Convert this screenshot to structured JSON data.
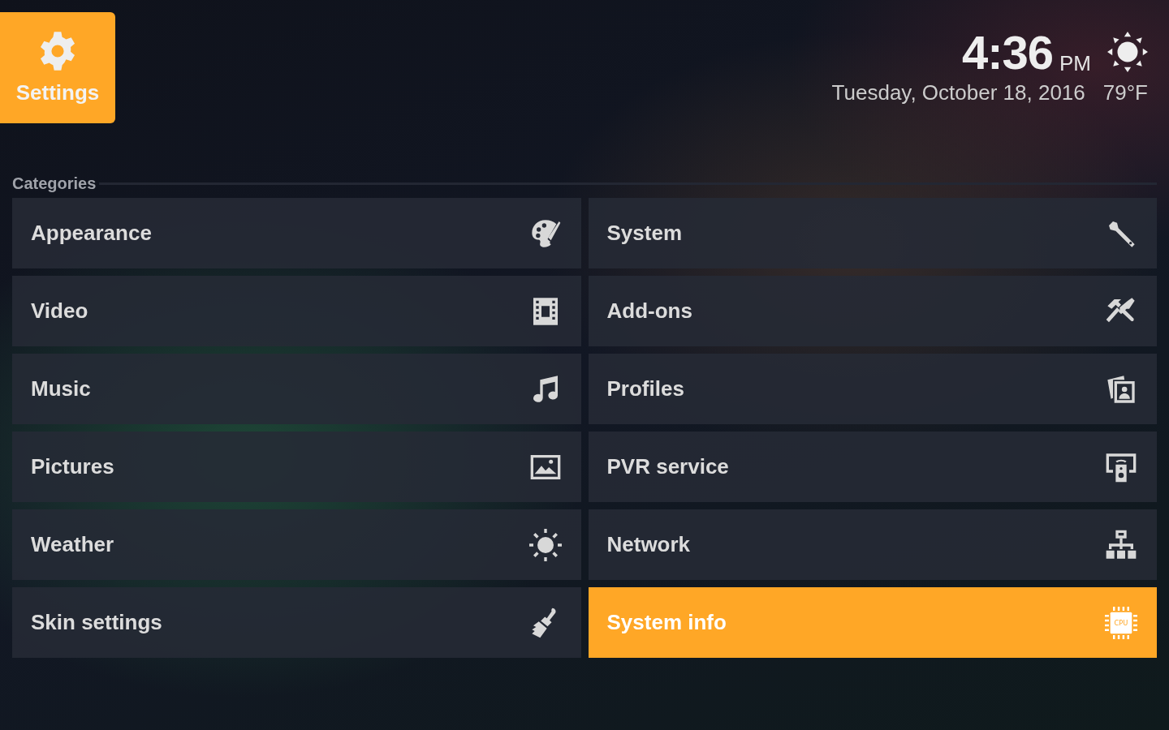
{
  "header": {
    "title": "Settings"
  },
  "clock": {
    "time": "4:36",
    "meridiem": "PM",
    "date": "Tuesday, October 18, 2016",
    "temperature": "79°F"
  },
  "section": {
    "label": "Categories"
  },
  "categories": [
    {
      "label": "Appearance",
      "kind": "palette",
      "selected": false
    },
    {
      "label": "System",
      "kind": "wrench",
      "selected": false
    },
    {
      "label": "Video",
      "kind": "film",
      "selected": false
    },
    {
      "label": "Add-ons",
      "kind": "tools",
      "selected": false
    },
    {
      "label": "Music",
      "kind": "note",
      "selected": false
    },
    {
      "label": "Profiles",
      "kind": "profiles",
      "selected": false
    },
    {
      "label": "Pictures",
      "kind": "image",
      "selected": false
    },
    {
      "label": "PVR service",
      "kind": "remote",
      "selected": false
    },
    {
      "label": "Weather",
      "kind": "sun",
      "selected": false
    },
    {
      "label": "Network",
      "kind": "network",
      "selected": false
    },
    {
      "label": "Skin settings",
      "kind": "brush",
      "selected": false
    },
    {
      "label": "System info",
      "kind": "chip",
      "icon_text": "CPU",
      "selected": true
    }
  ]
}
